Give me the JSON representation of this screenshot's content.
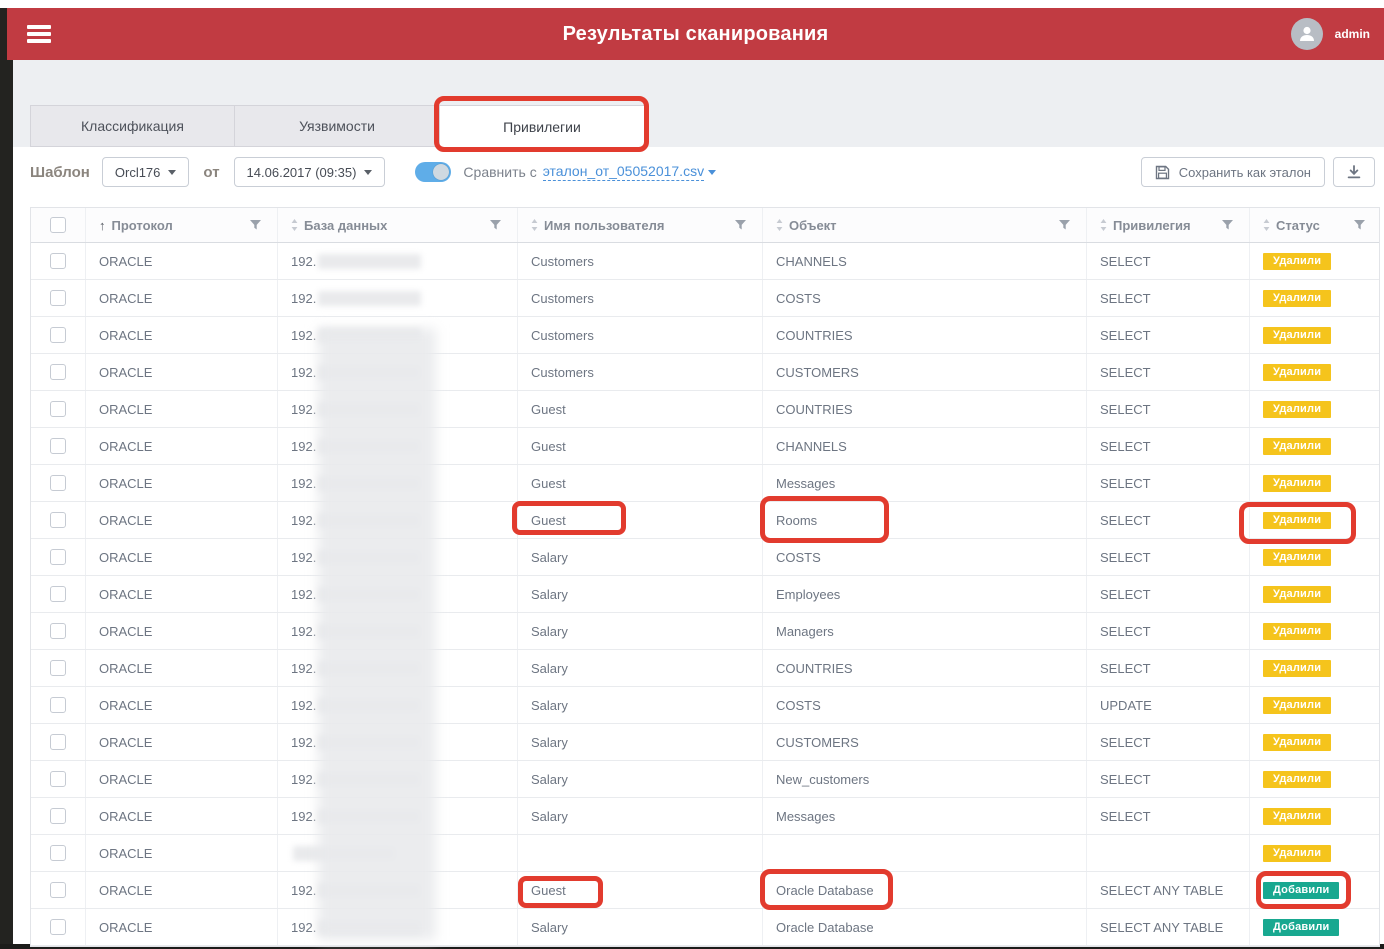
{
  "topbar": {
    "title": "Результаты сканирования",
    "user": "admin"
  },
  "tabs": [
    {
      "label": "Классификация",
      "active": false
    },
    {
      "label": "Уязвимости",
      "active": false
    },
    {
      "label": "Привилегии",
      "active": true
    }
  ],
  "toolbar": {
    "template_label": "Шаблон",
    "template_value": "Orcl176",
    "from_label": "от",
    "date_value": "14.06.2017 (09:35)",
    "compare_toggle_on": true,
    "compare_label": "Сравнить с",
    "compare_file": "эталон_от_05052017.csv",
    "save_button_label": "Сохранить как эталон"
  },
  "table": {
    "columns": [
      {
        "label": "Протокол",
        "sort": "asc"
      },
      {
        "label": "База данных",
        "sort": "none"
      },
      {
        "label": "Имя пользователя",
        "sort": "none"
      },
      {
        "label": "Объект",
        "sort": "none"
      },
      {
        "label": "Привилегия",
        "sort": "none"
      },
      {
        "label": "Статус",
        "sort": "none"
      }
    ],
    "redacted_ip_prefix": "192.",
    "rows": [
      {
        "protocol": "ORACLE",
        "db": "192.",
        "user": "Customers",
        "object": "CHANNELS",
        "privilege": "SELECT",
        "status": "Удалили",
        "status_type": "removed"
      },
      {
        "protocol": "ORACLE",
        "db": "192.",
        "user": "Customers",
        "object": "COSTS",
        "privilege": "SELECT",
        "status": "Удалили",
        "status_type": "removed"
      },
      {
        "protocol": "ORACLE",
        "db": "192.",
        "user": "Customers",
        "object": "COUNTRIES",
        "privilege": "SELECT",
        "status": "Удалили",
        "status_type": "removed"
      },
      {
        "protocol": "ORACLE",
        "db": "192.",
        "user": "Customers",
        "object": "CUSTOMERS",
        "privilege": "SELECT",
        "status": "Удалили",
        "status_type": "removed"
      },
      {
        "protocol": "ORACLE",
        "db": "192.",
        "user": "Guest",
        "object": "COUNTRIES",
        "privilege": "SELECT",
        "status": "Удалили",
        "status_type": "removed"
      },
      {
        "protocol": "ORACLE",
        "db": "192.",
        "user": "Guest",
        "object": "CHANNELS",
        "privilege": "SELECT",
        "status": "Удалили",
        "status_type": "removed"
      },
      {
        "protocol": "ORACLE",
        "db": "192.",
        "user": "Guest",
        "object": "Messages",
        "privilege": "SELECT",
        "status": "Удалили",
        "status_type": "removed"
      },
      {
        "protocol": "ORACLE",
        "db": "192.",
        "user": "Guest",
        "object": "Rooms",
        "privilege": "SELECT",
        "status": "Удалили",
        "status_type": "removed"
      },
      {
        "protocol": "ORACLE",
        "db": "192.",
        "user": "Salary",
        "object": "COSTS",
        "privilege": "SELECT",
        "status": "Удалили",
        "status_type": "removed"
      },
      {
        "protocol": "ORACLE",
        "db": "192.",
        "user": "Salary",
        "object": "Employees",
        "privilege": "SELECT",
        "status": "Удалили",
        "status_type": "removed"
      },
      {
        "protocol": "ORACLE",
        "db": "192.",
        "user": "Salary",
        "object": "Managers",
        "privilege": "SELECT",
        "status": "Удалили",
        "status_type": "removed"
      },
      {
        "protocol": "ORACLE",
        "db": "192.",
        "user": "Salary",
        "object": "COUNTRIES",
        "privilege": "SELECT",
        "status": "Удалили",
        "status_type": "removed"
      },
      {
        "protocol": "ORACLE",
        "db": "192.",
        "user": "Salary",
        "object": "COSTS",
        "privilege": "UPDATE",
        "status": "Удалили",
        "status_type": "removed"
      },
      {
        "protocol": "ORACLE",
        "db": "192.",
        "user": "Salary",
        "object": "CUSTOMERS",
        "privilege": "SELECT",
        "status": "Удалили",
        "status_type": "removed"
      },
      {
        "protocol": "ORACLE",
        "db": "192.",
        "user": "Salary",
        "object": "New_customers",
        "privilege": "SELECT",
        "status": "Удалили",
        "status_type": "removed"
      },
      {
        "protocol": "ORACLE",
        "db": "192.",
        "user": "Salary",
        "object": "Messages",
        "privilege": "SELECT",
        "status": "Удалили",
        "status_type": "removed"
      },
      {
        "protocol": "ORACLE",
        "db": "",
        "user": "",
        "object": "",
        "privilege": "",
        "status": "Удалили",
        "status_type": "removed"
      },
      {
        "protocol": "ORACLE",
        "db": "192.",
        "user": "Guest",
        "object": "Oracle Database",
        "privilege": "SELECT ANY TABLE",
        "status": "Добавили",
        "status_type": "added"
      },
      {
        "protocol": "ORACLE",
        "db": "192.",
        "user": "Salary",
        "object": "Oracle Database",
        "privilege": "SELECT ANY TABLE",
        "status": "Добавили",
        "status_type": "added"
      }
    ]
  },
  "badges": {
    "removed_label": "Удалили",
    "removed_color": "#f5c41c",
    "added_label": "Добавили",
    "added_color": "#18a890"
  },
  "annotations": {
    "color": "#e23b2e",
    "targets": [
      "tab-privileges",
      "row-8-user",
      "row-8-object",
      "row-8-status",
      "row-18-user",
      "row-18-object",
      "row-18-status"
    ]
  },
  "colors": {
    "topbar_red": "#c13b42",
    "link_blue": "#4a90d9",
    "toggle_blue": "#5fade8"
  }
}
